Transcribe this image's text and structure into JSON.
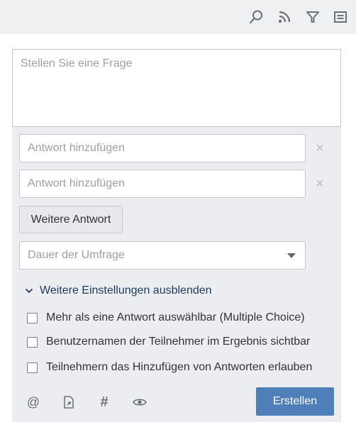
{
  "toolbar": {
    "icons": [
      "search-icon",
      "rss-icon",
      "filter-icon",
      "list-view-icon"
    ]
  },
  "form": {
    "question_placeholder": "Stellen Sie eine Frage",
    "answers": [
      {
        "placeholder": "Antwort hinzufügen",
        "remove_glyph": "×"
      },
      {
        "placeholder": "Antwort hinzufügen",
        "remove_glyph": "×"
      }
    ],
    "more_answer_label": "Weitere Antwort",
    "duration_placeholder": "Dauer der Umfrage",
    "settings_toggle_label": "Weitere Einstellungen ausblenden",
    "options": [
      {
        "label": "Mehr als eine Antwort auswählbar (Multiple Choice)",
        "checked": false
      },
      {
        "label": "Benutzernamen der Teilnehmer im Ergebnis sichtbar",
        "checked": false
      },
      {
        "label": "Teilnehmern das Hinzufügen von Antworten erlauben",
        "checked": false
      }
    ],
    "footer_icons": [
      "mention-icon",
      "attachment-icon",
      "hashtag-icon",
      "visibility-icon"
    ],
    "mention_glyph": "@",
    "hashtag_glyph": "#",
    "create_label": "Erstellen"
  },
  "colors": {
    "accent": "#4f7fb9",
    "panel_bg": "#ebedf0",
    "link": "#1e3a5f"
  }
}
